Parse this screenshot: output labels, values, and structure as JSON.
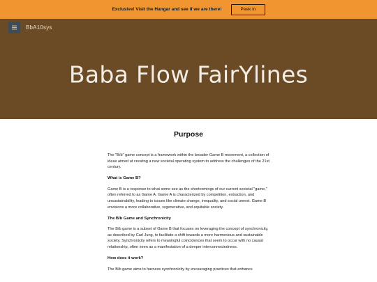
{
  "promo": {
    "text": "Exclusive! Visit the Hangar and see if we are there!",
    "button_label": "Peek In"
  },
  "brand": {
    "name": "BbA10sys",
    "logo_icon": "menu-lines-icon"
  },
  "hero": {
    "title": "Baba Flow FairYlines"
  },
  "colors": {
    "promo_bg": "#f0952f",
    "hero_bg": "#6b4a26",
    "logo_bg": "#3f4b59"
  },
  "main": {
    "section_title": "Purpose",
    "blocks": [
      {
        "type": "p",
        "text": "The \"B/b\" game concept is a framework within the broader Game B movement, a collection of ideas aimed at creating a new societal operating system to address the challenges of the 21st century."
      },
      {
        "type": "h",
        "text": "What is Game B?"
      },
      {
        "type": "p",
        "text": "Game B is a response to what some see as the shortcomings of our current societal \"game,\" often referred to as Game A. Game A is characterized by competition, extraction, and unsustainability, leading to issues like climate change, inequality, and social unrest. Game B envisions a more collaborative, regenerative, and equitable society."
      },
      {
        "type": "h",
        "text": "The B/b Game and Synchronicity"
      },
      {
        "type": "p",
        "text": "The B/b game is a subset of Game B that focuses on leveraging the concept of synchronicity, as described by Carl Jung, to facilitate a shift towards a more harmonious and sustainable society. Synchronicity refers to meaningful coincidences that seem to occur with no causal relationship, often seen as a manifestation of a deeper interconnectedness."
      },
      {
        "type": "h",
        "text": "How does it work?"
      },
      {
        "type": "p",
        "text": "The B/b game aims to harness synchronicity by encouraging practices that enhance"
      }
    ]
  }
}
